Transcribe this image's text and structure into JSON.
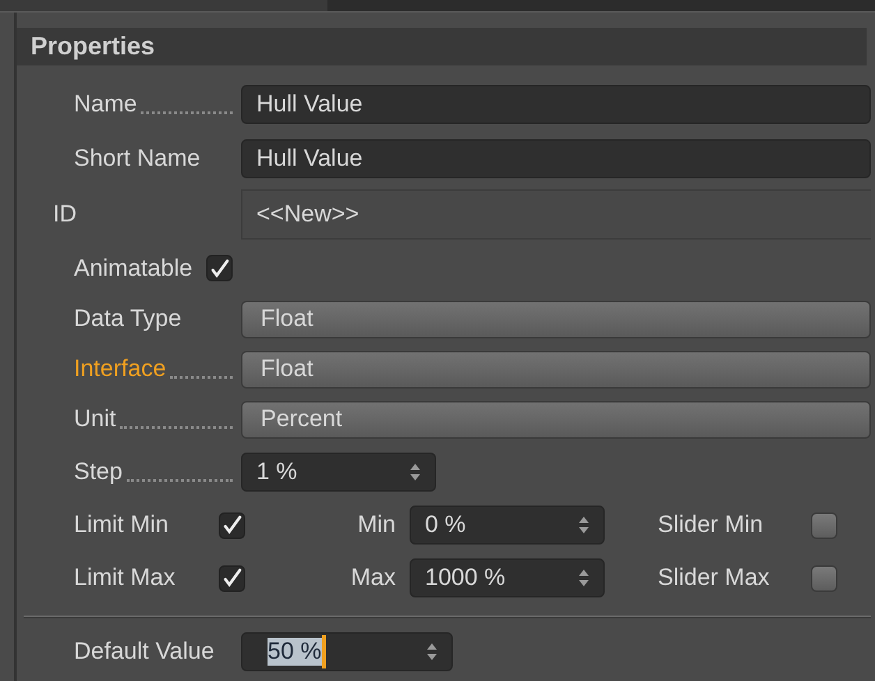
{
  "panel": {
    "title": "Properties"
  },
  "rows": [
    {
      "kind": "text",
      "label": "Name",
      "leader": true,
      "value": "Hull Value"
    },
    {
      "kind": "text",
      "label": "Short Name",
      "leader": false,
      "value": "Hull Value"
    },
    {
      "kind": "id",
      "label": "ID",
      "value": "<<New>>"
    },
    {
      "kind": "check",
      "label": "Animatable",
      "checked": true
    },
    {
      "kind": "dropdown",
      "label": "Data Type",
      "leader": false,
      "highlighted": false,
      "value": "Float"
    },
    {
      "kind": "dropdown",
      "label": "Interface",
      "leader": true,
      "highlighted": true,
      "value": "Float"
    },
    {
      "kind": "dropdown",
      "label": "Unit",
      "leader": true,
      "highlighted": false,
      "value": "Percent"
    },
    {
      "kind": "spinner",
      "label": "Step",
      "leader": true,
      "value": "1 %"
    },
    {
      "kind": "limit",
      "label": "Limit Min",
      "checked": true,
      "field_label": "Min",
      "value": "0 %",
      "slider_label": "Slider Min",
      "slider_checked": false
    },
    {
      "kind": "limit",
      "label": "Limit Max",
      "checked": true,
      "field_label": "Max",
      "value": "1000 %",
      "slider_label": "Slider Max",
      "slider_checked": false
    }
  ],
  "default_value": {
    "label": "Default Value",
    "value": "50 %",
    "text_selected": true
  }
}
